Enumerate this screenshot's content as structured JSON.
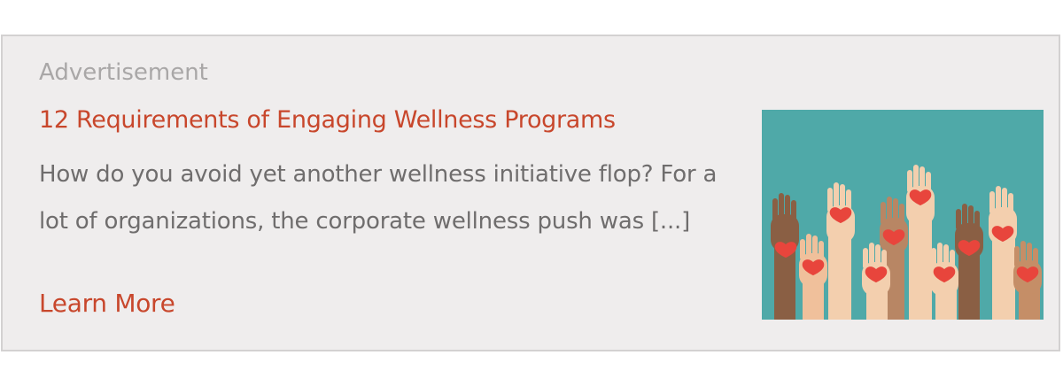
{
  "ad": {
    "label": "Advertisement",
    "title": "12 Requirements of Engaging Wellness Programs",
    "excerpt": "How do you avoid yet another wellness initiative flop? For a lot of organizations, the corporate wellness push was [...]",
    "cta": "Learn More",
    "image_icon": "raised-hands-with-hearts-illustration"
  },
  "colors": {
    "card_background": "#efeded",
    "card_border": "#d3d1d1",
    "accent": "#c8472c",
    "label": "#a9a7a7",
    "body_text": "#6f6d6d",
    "image_background": "#4fa9a8",
    "heart": "#e8453c"
  }
}
